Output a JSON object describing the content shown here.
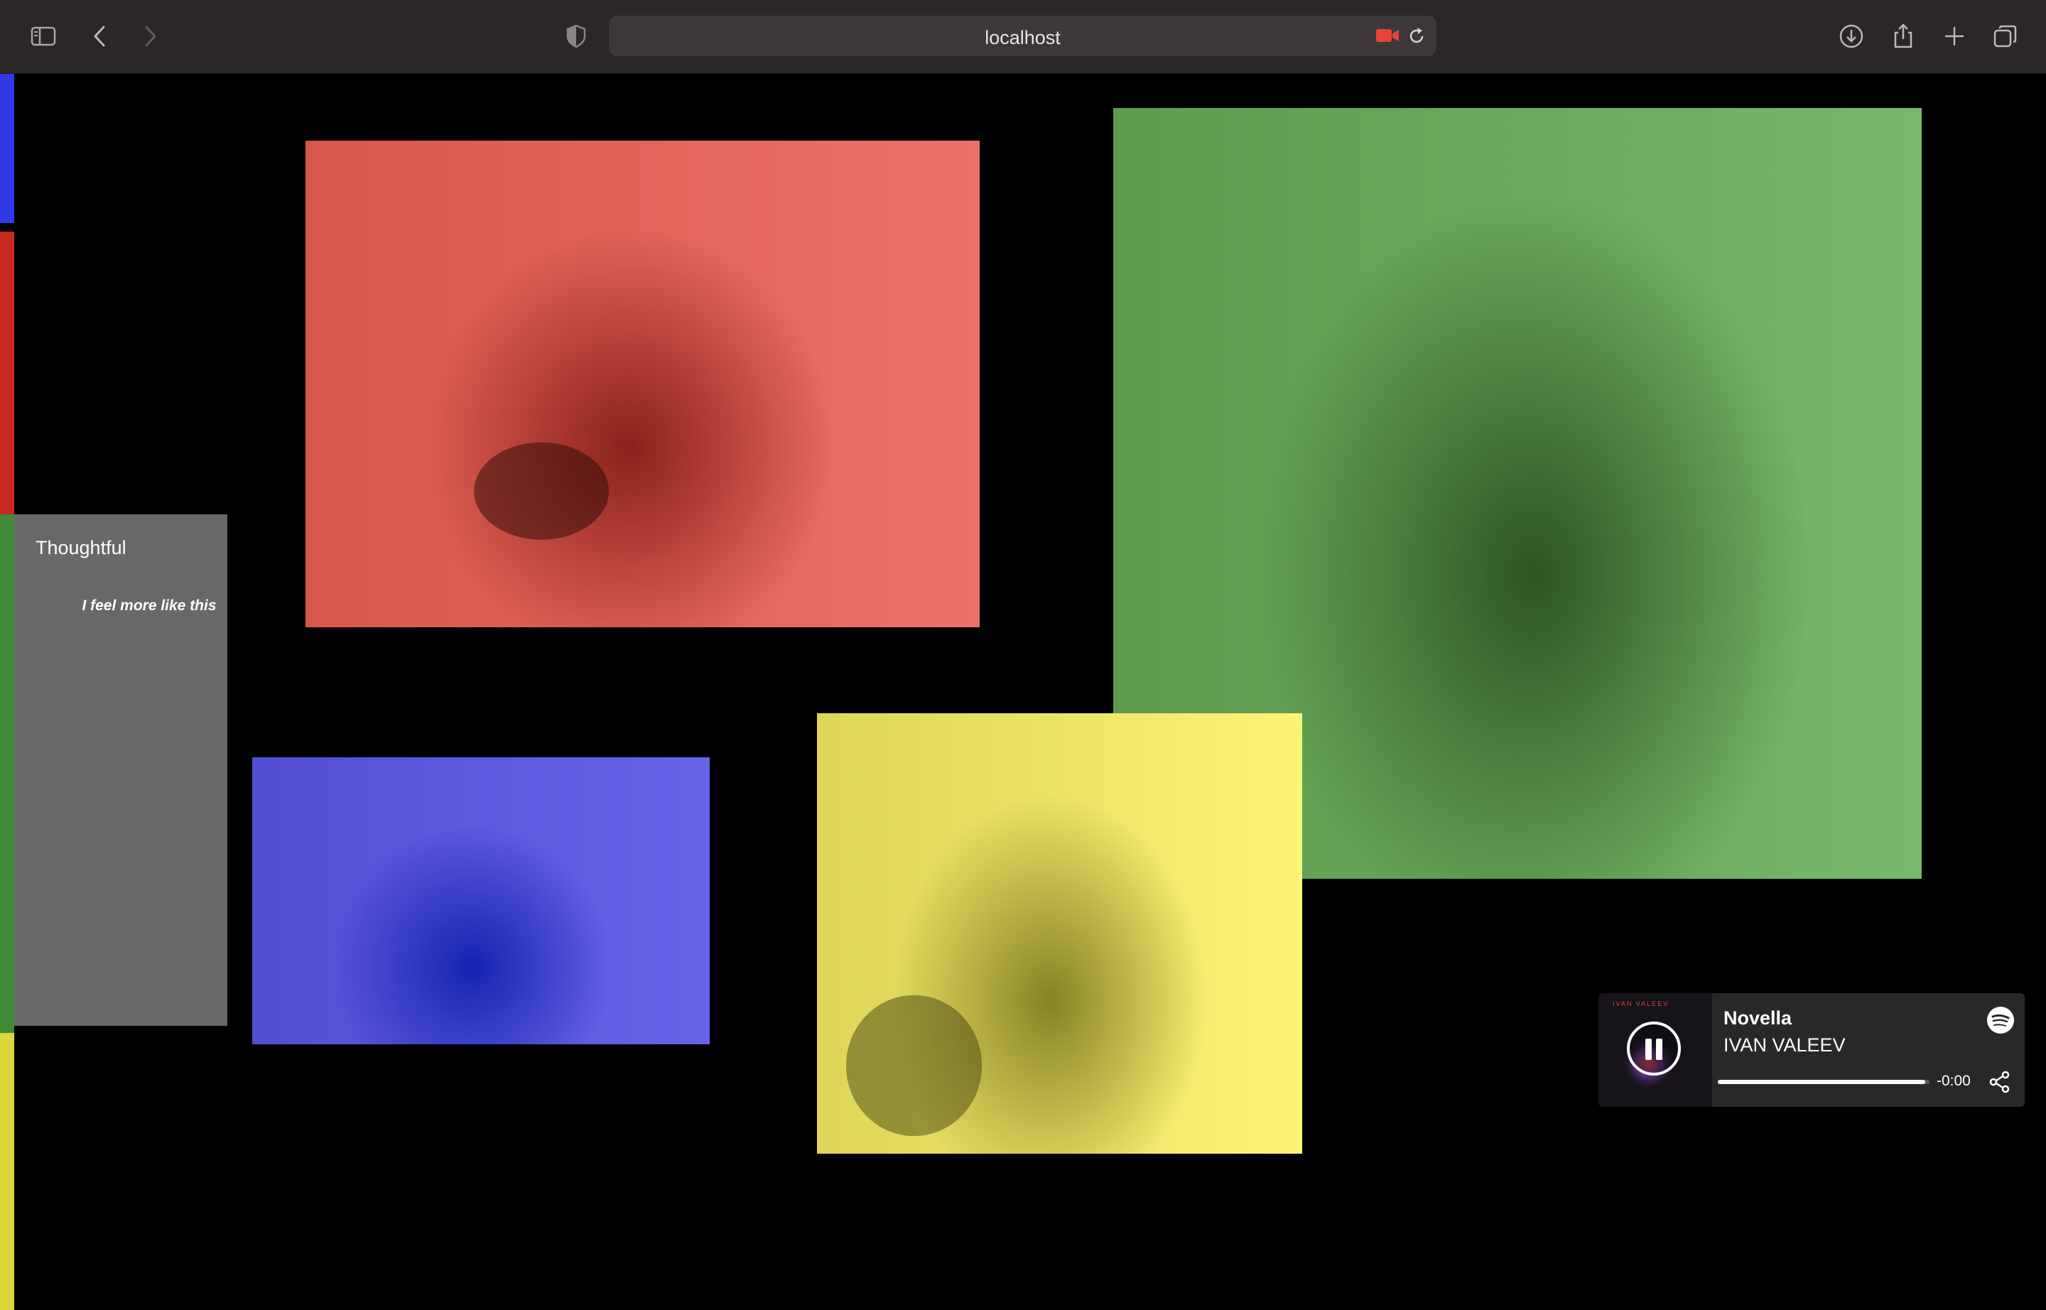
{
  "browser": {
    "url": "localhost",
    "icons": [
      "sidebar-icon",
      "back-icon",
      "forward-icon",
      "shield-icon",
      "camera-icon",
      "reload-icon",
      "download-icon",
      "share-icon",
      "new-tab-icon",
      "tabs-icon"
    ]
  },
  "note": {
    "title": "Thoughtful",
    "text": "I feel more like this"
  },
  "strips": {
    "colors": [
      "#2d3ae6",
      "#c8281f",
      "#3e8a37",
      "#dcd63d"
    ]
  },
  "videos": [
    {
      "name": "red",
      "color": "#e8675c"
    },
    {
      "name": "green",
      "color": "#6fb05e"
    },
    {
      "name": "blue",
      "color": "#5a58e0"
    },
    {
      "name": "yellow",
      "color": "#f3ec6a"
    }
  ],
  "player": {
    "track": "Novella",
    "artist": "IVAN VALEEV",
    "time": "-0:00",
    "progress": 0.98,
    "cover_title": "IVAN VALEEV",
    "state": "playing",
    "icons": [
      "pause-icon",
      "spotify-icon",
      "share-icon"
    ]
  }
}
